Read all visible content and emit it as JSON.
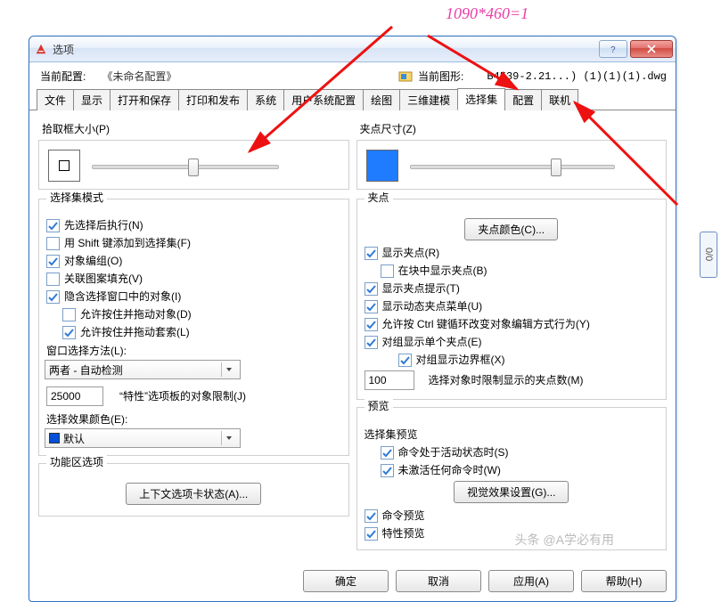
{
  "annotation_top": "1090*460=1",
  "watermark": "头条 @A学必有用",
  "side_tab": "0/0",
  "dialog": {
    "title": "选项",
    "header": {
      "profile_label": "当前配置:",
      "profile_value": "《未命名配置》",
      "drawing_label": "当前图形:",
      "drawing_value": "B4539-2.21...) (1)(1)(1).dwg"
    },
    "tabs": [
      "文件",
      "显示",
      "打开和保存",
      "打印和发布",
      "系统",
      "用户系统配置",
      "绘图",
      "三维建模",
      "选择集",
      "配置",
      "联机"
    ],
    "active_tab": 8,
    "left": {
      "pickbox_label": "拾取框大小(P)",
      "mode_group": "选择集模式",
      "cks": {
        "noun_verb": "先选择后执行(N)",
        "shift_add": "用 Shift 键添加到选择集(F)",
        "obj_group": "对象编组(O)",
        "assoc_hatch": "关联图案填充(V)",
        "implied_win": "隐含选择窗口中的对象(I)",
        "press_drag_obj": "允许按住并拖动对象(D)",
        "press_drag_lasso": "允许按住并拖动套索(L)"
      },
      "win_method_label": "窗口选择方法(L):",
      "win_method_value": "两者 - 自动检测",
      "prop_limit_value": "25000",
      "prop_limit_label": "“特性”选项板的对象限制(J)",
      "effect_color_label": "选择效果颜色(E):",
      "effect_color_value": "默认",
      "ribbon_label": "功能区选项",
      "ribbon_btn": "上下文选项卡状态(A)..."
    },
    "right": {
      "gripsize_label": "夹点尺寸(Z)",
      "grip_group": "夹点",
      "grip_color_btn": "夹点颜色(C)...",
      "cks": {
        "show_grips": "显示夹点(R)",
        "in_block": "在块中显示夹点(B)",
        "tips": "显示夹点提示(T)",
        "dyn_menu": "显示动态夹点菜单(U)",
        "ctrl_cycle": "允许按 Ctrl 键循环改变对象编辑方式行为(Y)",
        "single_group": "对组显示单个夹点(E)",
        "group_bbox": "对组显示边界框(X)",
        "limit_label": "选择对象时限制显示的夹点数(M)",
        "limit_value": "100"
      },
      "preview_group": "预览",
      "sel_preview_label": "选择集预览",
      "cks2": {
        "when_active": "命令处于活动状态时(S)",
        "no_cmd": "未激活任何命令时(W)"
      },
      "visual_btn": "视觉效果设置(G)...",
      "cmd_preview": "命令预览",
      "prop_preview": "特性预览"
    },
    "buttons": {
      "ok": "确定",
      "cancel": "取消",
      "apply": "应用(A)",
      "help": "帮助(H)"
    }
  }
}
